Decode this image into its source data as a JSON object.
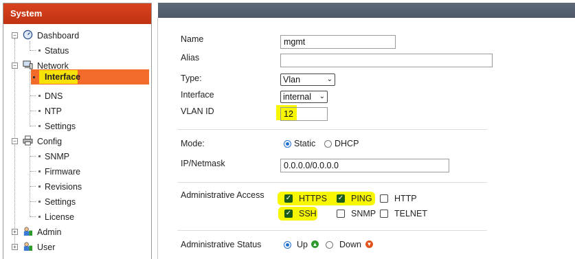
{
  "sidebar": {
    "title": "System",
    "items": [
      {
        "label": "Dashboard",
        "icon": "dashboard-gauge-icon",
        "expanded": true
      },
      {
        "label": "Status"
      },
      {
        "label": "Network",
        "icon": "network-computer-icon",
        "expanded": true
      },
      {
        "label": "Interface",
        "selected": true
      },
      {
        "label": "DNS"
      },
      {
        "label": "NTP"
      },
      {
        "label": "Settings"
      },
      {
        "label": "Config",
        "icon": "config-printer-icon",
        "expanded": true
      },
      {
        "label": "SNMP"
      },
      {
        "label": "Firmware"
      },
      {
        "label": "Revisions"
      },
      {
        "label": "Settings"
      },
      {
        "label": "License"
      },
      {
        "label": "Admin",
        "icon": "admin-users-icon",
        "expanded": false
      },
      {
        "label": "User",
        "icon": "user-users-icon",
        "expanded": false
      }
    ]
  },
  "form": {
    "name_label": "Name",
    "name_value": "mgmt",
    "alias_label": "Alias",
    "alias_value": "",
    "type_label": "Type:",
    "type_value": "Vlan",
    "interface_label": "Interface",
    "interface_value": "internal",
    "vlan_label": "VLAN ID",
    "vlan_value": "12",
    "mode_label": "Mode:",
    "mode_static": "Static",
    "mode_dhcp": "DHCP",
    "mode_selected": "Static",
    "ip_label": "IP/Netmask",
    "ip_value": "0.0.0.0/0.0.0.0",
    "access_label": "Administrative Access",
    "access": [
      {
        "label": "HTTPS",
        "checked": true
      },
      {
        "label": "PING",
        "checked": true
      },
      {
        "label": "HTTP",
        "checked": false
      },
      {
        "label": "SSH",
        "checked": true
      },
      {
        "label": "SNMP",
        "checked": false
      },
      {
        "label": "TELNET",
        "checked": false
      }
    ],
    "status_label": "Administrative Status",
    "status_up": "Up",
    "status_down": "Down",
    "status_selected": "Up"
  },
  "colors": {
    "accent": "#c13312",
    "selected_bg": "#f26b2a",
    "highlight": "#f7f701",
    "up_icon": "#2e9a2e",
    "down_icon": "#e0531c",
    "topbar": "#566070"
  }
}
